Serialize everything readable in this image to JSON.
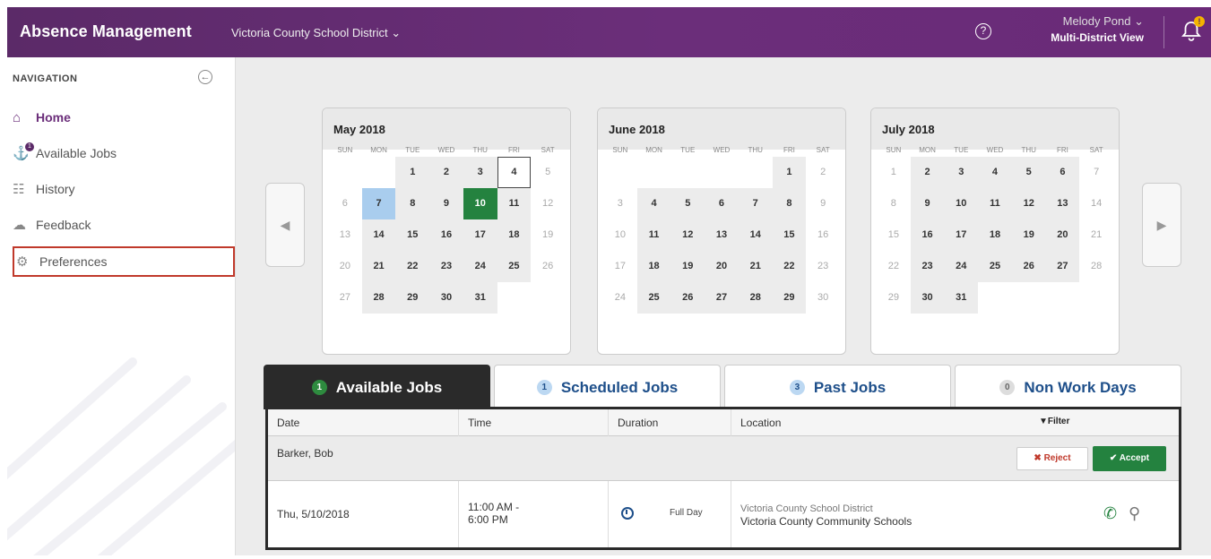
{
  "header": {
    "app_title": "Absence Management",
    "district": "Victoria County School District ⌄",
    "help": "?",
    "user_name": "Melody Pond ⌄",
    "view": "Multi-District View",
    "bell_badge": "!"
  },
  "sidebar": {
    "title": "NAVIGATION",
    "collapse": "←",
    "items": [
      {
        "label": "Home",
        "icon": "home-icon",
        "glyph": "⌂"
      },
      {
        "label": "Available Jobs",
        "icon": "jobs-icon",
        "glyph": "⚓"
      },
      {
        "label": "History",
        "icon": "history-icon",
        "glyph": "☷"
      },
      {
        "label": "Feedback",
        "icon": "feedback-icon",
        "glyph": "☁"
      },
      {
        "label": "Preferences",
        "icon": "gear-icon",
        "glyph": "⚙"
      }
    ],
    "jobs_badge": "1"
  },
  "calendar": {
    "dows": [
      "SUN",
      "MON",
      "TUE",
      "WED",
      "THU",
      "FRI",
      "SAT"
    ],
    "months": [
      {
        "title": "May 2018",
        "start": 2,
        "days": 31,
        "today": 4,
        "blue": 7,
        "green": 10
      },
      {
        "title": "June 2018",
        "start": 5,
        "days": 30
      },
      {
        "title": "July 2018",
        "start": 0,
        "days": 31
      }
    ]
  },
  "tabs": [
    {
      "count": "1",
      "label": "Available Jobs"
    },
    {
      "count": "1",
      "label": "Scheduled Jobs"
    },
    {
      "count": "3",
      "label": "Past Jobs"
    },
    {
      "count": "0",
      "label": "Non Work Days"
    }
  ],
  "table": {
    "columns": [
      "Date",
      "Time",
      "Duration",
      "Location"
    ],
    "filter": "▼Filter",
    "group": "Barker, Bob",
    "reject": "✖ Reject",
    "accept": "✔ Accept",
    "row": {
      "date": "Thu, 5/10/2018",
      "time1": "11:00 AM -",
      "time2": "6:00 PM",
      "duration": "Full Day",
      "location1": "Victoria County School District",
      "location2": "Victoria County Community Schools"
    }
  },
  "colors": {
    "brand": "#5b2a68",
    "accept": "#24823f",
    "reject": "#c0392b"
  }
}
